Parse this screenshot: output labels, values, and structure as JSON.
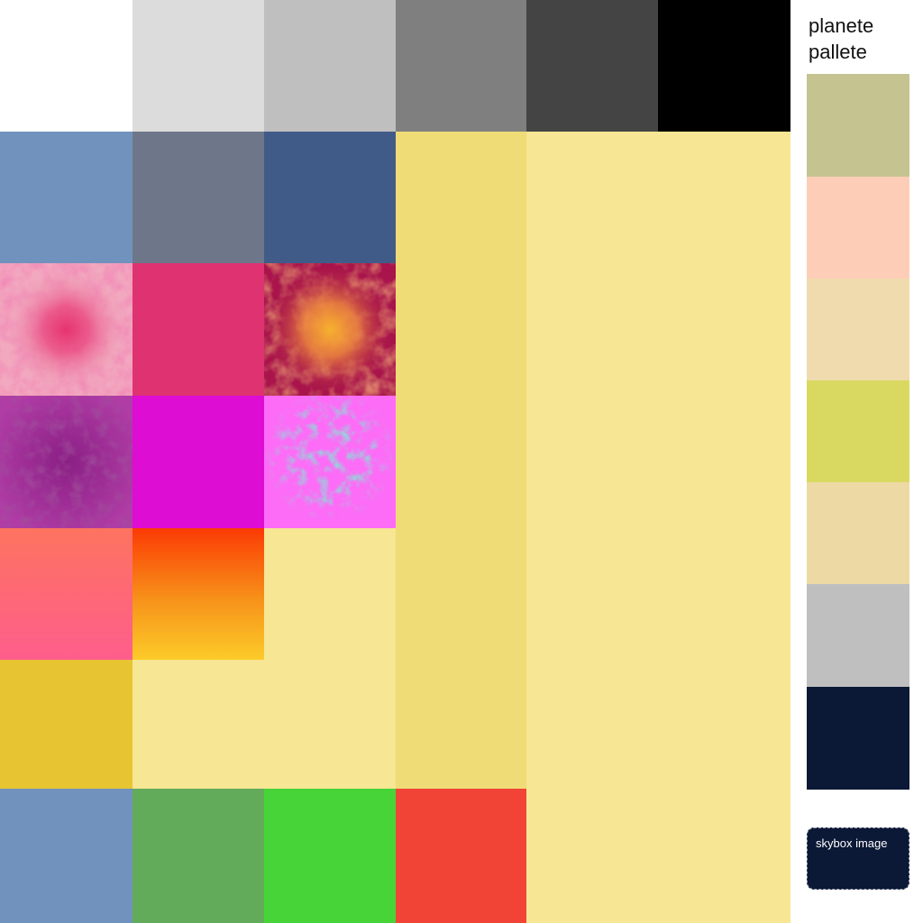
{
  "palette": {
    "title": "planete pallete",
    "swatches": [
      {
        "color": "#c5c491"
      },
      {
        "color": "#fdcdb7"
      },
      {
        "color": "#f0dbae"
      },
      {
        "color": "#d9d961"
      },
      {
        "color": "#edd9a4"
      },
      {
        "color": "#bfbfbf"
      },
      {
        "color": "#0b1836"
      }
    ]
  },
  "skybox_button": {
    "label": "skybox image",
    "color": "#0b1836"
  },
  "tiles": {
    "grayscale": [
      "#ffffff",
      "#dcdcdc",
      "#bfbfbf",
      "#7f7f7f",
      "#444444",
      "#000000"
    ],
    "blue_row": [
      "#7092bd",
      "#6e7789",
      "#415b89"
    ],
    "yellow_column": "#efdc76",
    "yellow_wide": "#f7e693",
    "pink_solid": "#df3271",
    "magenta_solid": "#dd0dd4",
    "gold": "#e7c432",
    "bottom_row": [
      "#7092bd",
      "#62ab5a",
      "#46d438",
      "#f14437"
    ]
  }
}
